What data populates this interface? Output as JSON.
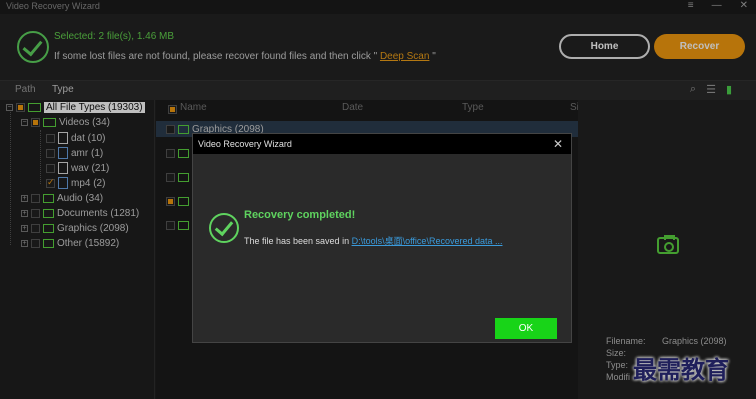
{
  "window": {
    "title": "Video Recovery Wizard",
    "controls": [
      "≡",
      "—",
      "✕"
    ]
  },
  "header": {
    "selected": "Selected: 2 file(s), 1.46 MB",
    "hint": "If some lost files are not found, please recover found files and then click \" ",
    "hint_link": "Deep Scan",
    "hint_end": " \"",
    "home_label": "Home",
    "recover_label": "Recover"
  },
  "tabs": [
    {
      "label": "Path"
    },
    {
      "label": "Type"
    }
  ],
  "tree": {
    "root": "All File Types (19303)",
    "videos": "Videos (34)",
    "dat": "dat (10)",
    "amr": "amr (1)",
    "wav": "wav (21)",
    "mp4": "mp4 (2)",
    "audio": "Audio (34)",
    "documents": "Documents (1281)",
    "graphics": "Graphics (2098)",
    "other": "Other (15892)"
  },
  "list": {
    "columns": [
      "Name",
      "Date",
      "Type",
      "Si"
    ],
    "first_row": "Graphics (2098)"
  },
  "preview": {
    "filename_label": "Filename:",
    "filename_value": "Graphics (2098)",
    "size_label": "Size:",
    "type_label": "Type:",
    "modified_label": "Modifi"
  },
  "watermark": "最需教育",
  "dialog": {
    "title": "Video Recovery Wizard",
    "heading": "Recovery completed!",
    "message": "The file has been saved in ",
    "path": "D:\\tools\\桌面\\office\\Recovered data ...",
    "ok_label": "OK"
  }
}
